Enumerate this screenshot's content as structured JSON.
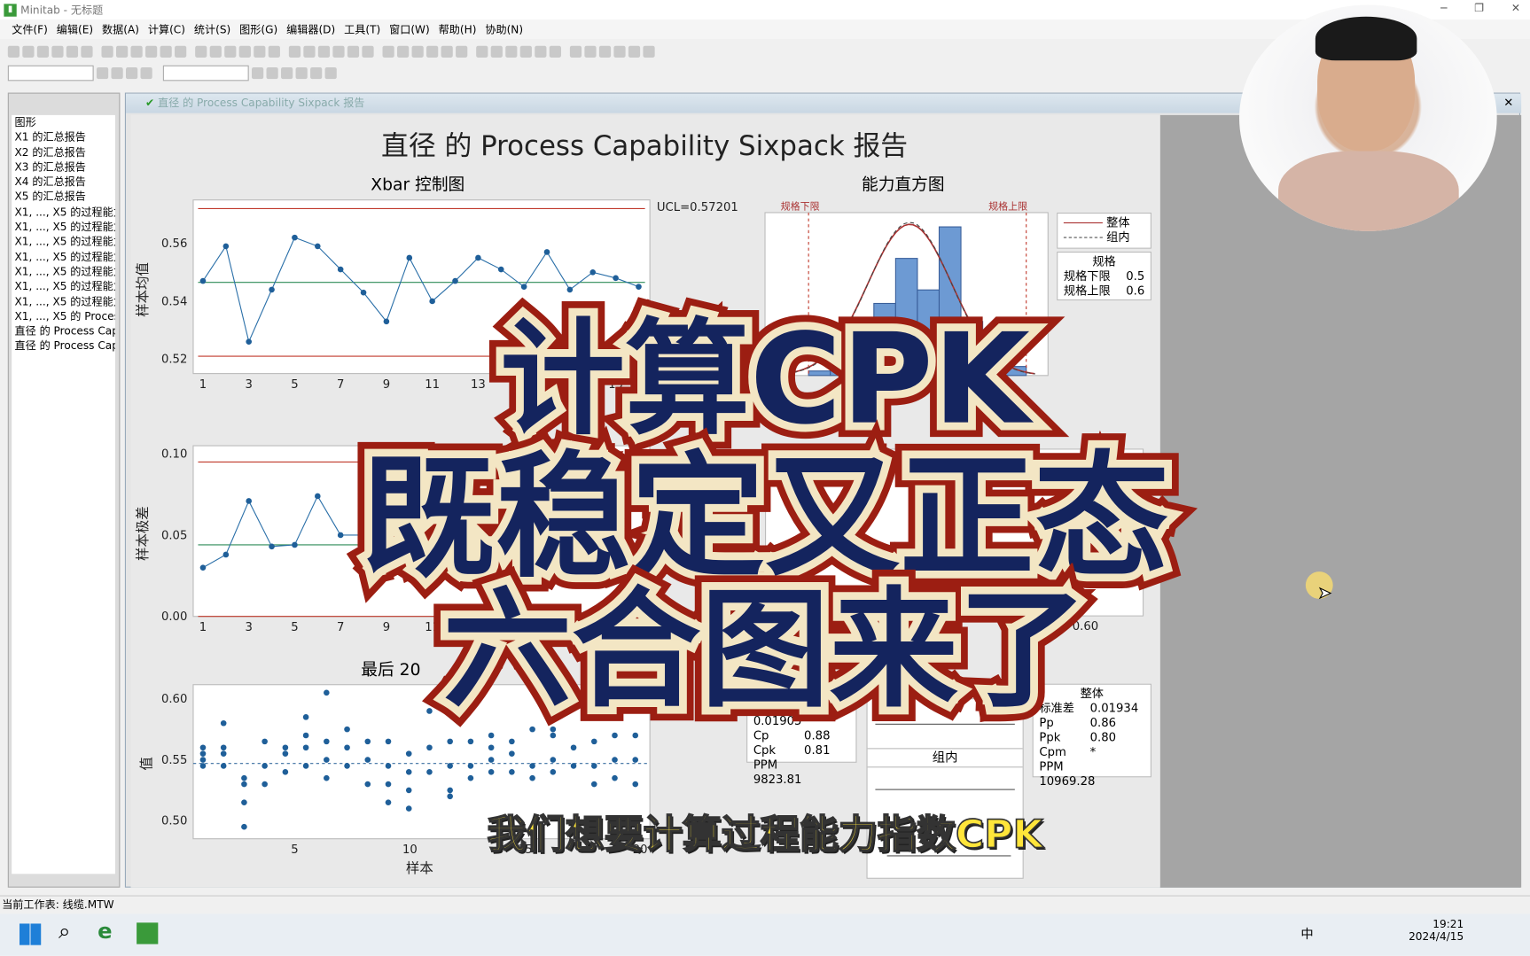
{
  "window": {
    "title": "Minitab - 无标题",
    "min": "─",
    "max": "❐",
    "close": "✕"
  },
  "menu": [
    "文件(F)",
    "编辑(E)",
    "数据(A)",
    "计算(C)",
    "统计(S)",
    "图形(G)",
    "编辑器(D)",
    "工具(T)",
    "窗口(W)",
    "帮助(H)",
    "协助(N)"
  ],
  "project": {
    "header": "图形",
    "items": [
      "X1 的汇总报告",
      "X2 的汇总报告",
      "X3 的汇总报告",
      "X4 的汇总报告",
      "X5 的汇总报告",
      "X1, ..., X5 的过程能力",
      "X1, ..., X5 的过程能力",
      "X1, ..., X5 的过程能力",
      "X1, ..., X5 的过程能力",
      "X1, ..., X5 的过程能力",
      "X1, ..., X5 的过程能力",
      "X1, ..., X5 的过程能力",
      "X1, ..., X5 的 Process",
      "直径 的 Process Cap",
      "直径 的 Process Cap"
    ]
  },
  "graph_window": {
    "title": "直径 的 Process Capability Sixpack 报告",
    "close": "✕"
  },
  "report": {
    "title": "直径 的 Process Capability Sixpack 报告",
    "xbar": {
      "title": "Xbar 控制图",
      "ylabel": "样本均值",
      "ucl_label": "UCL=0.57201"
    },
    "r": {
      "ylabel": "样本极差"
    },
    "last": {
      "title": "最后 20",
      "ylabel": "值",
      "xlabel": "样本"
    },
    "hist": {
      "title": "能力直方图",
      "lsl": "规格下限",
      "usl": "规格上限",
      "legend": [
        "整体",
        "组内"
      ],
      "spec_title": "规格",
      "spec": [
        {
          "k": "规格下限",
          "v": "0.5"
        },
        {
          "k": "规格上限",
          "v": "0.6"
        }
      ],
      "tick": "0.56"
    },
    "prob": {
      "tick": "0.60"
    },
    "within": {
      "title": "组内",
      "rows": [
        {
          "k": "标准差",
          "v": "0.01905"
        },
        {
          "k": "Cp",
          "v": "0.88"
        },
        {
          "k": "Cpk",
          "v": "0.81"
        },
        {
          "k": "PPM",
          "v": "9823.81"
        }
      ]
    },
    "overall": {
      "title": "整体",
      "rows": [
        {
          "k": "标准差",
          "v": "0.01934"
        },
        {
          "k": "Pp",
          "v": "0.86"
        },
        {
          "k": "Ppk",
          "v": "0.80"
        },
        {
          "k": "Cpm",
          "v": "*"
        },
        {
          "k": "PPM",
          "v": "10969.28"
        }
      ]
    },
    "capplot": {
      "overall": "整体",
      "within": "组内"
    }
  },
  "chart_data": [
    {
      "type": "line",
      "title": "Xbar 控制图",
      "ylabel": "样本均值",
      "x": [
        1,
        2,
        3,
        4,
        5,
        6,
        7,
        8,
        9,
        10,
        11,
        12,
        13,
        14,
        15,
        16,
        17,
        18,
        19,
        20
      ],
      "values": [
        0.547,
        0.559,
        0.526,
        0.544,
        0.562,
        0.559,
        0.551,
        0.543,
        0.533,
        0.555,
        0.54,
        0.547,
        0.555,
        0.551,
        0.545,
        0.557,
        0.544,
        0.55,
        0.548,
        0.545
      ],
      "ucl": 0.57201,
      "center": 0.5465,
      "lcl": 0.521,
      "ylim": [
        0.515,
        0.575
      ],
      "yticks": [
        "0.52",
        "0.54",
        "0.56"
      ],
      "xticks": [
        "1",
        "3",
        "5",
        "7",
        "9",
        "11",
        "13",
        "15",
        "17",
        "19"
      ],
      "colors": {
        "line": "#2a6fa8",
        "limits": "#c0392b",
        "center": "#2e8b57"
      }
    },
    {
      "type": "line",
      "ylabel": "样本极差",
      "x": [
        1,
        2,
        3,
        4,
        5,
        6,
        7,
        8,
        9,
        10,
        11,
        12,
        13,
        14,
        15,
        16,
        17,
        18,
        19,
        20
      ],
      "values": [
        0.03,
        0.038,
        0.071,
        0.043,
        0.044,
        0.074,
        0.05,
        0.05,
        0.045,
        0.04,
        0.025,
        0.045,
        0.05,
        0.04,
        0.035,
        0.03,
        0.022,
        0.045,
        0.06,
        0.068
      ],
      "ucl": 0.095,
      "center": 0.044,
      "lcl": 0,
      "ylim": [
        0,
        0.105
      ],
      "yticks": [
        "0.00",
        "0.05",
        "0.10"
      ],
      "xticks": [
        "1",
        "3",
        "5",
        "7",
        "9",
        "11",
        "13",
        "15",
        "17",
        "19"
      ]
    },
    {
      "type": "scatter",
      "title": "最后 20",
      "ylabel": "值",
      "xlabel": "样本",
      "ylim": [
        0.49,
        0.61
      ],
      "yticks": [
        "0.50",
        "0.55",
        "0.60"
      ],
      "xticks": [
        "5",
        "10",
        "15",
        "20"
      ],
      "center": 0.547,
      "points": [
        [
          1,
          0.56
        ],
        [
          1,
          0.555
        ],
        [
          1,
          0.55
        ],
        [
          1,
          0.545
        ],
        [
          2,
          0.58
        ],
        [
          2,
          0.56
        ],
        [
          2,
          0.555
        ],
        [
          2,
          0.545
        ],
        [
          3,
          0.535
        ],
        [
          3,
          0.53
        ],
        [
          3,
          0.515
        ],
        [
          3,
          0.495
        ],
        [
          4,
          0.565
        ],
        [
          4,
          0.545
        ],
        [
          4,
          0.53
        ],
        [
          5,
          0.56
        ],
        [
          5,
          0.555
        ],
        [
          5,
          0.54
        ],
        [
          6,
          0.585
        ],
        [
          6,
          0.57
        ],
        [
          6,
          0.56
        ],
        [
          6,
          0.545
        ],
        [
          7,
          0.605
        ],
        [
          7,
          0.565
        ],
        [
          7,
          0.55
        ],
        [
          7,
          0.535
        ],
        [
          8,
          0.575
        ],
        [
          8,
          0.56
        ],
        [
          8,
          0.545
        ],
        [
          9,
          0.565
        ],
        [
          9,
          0.55
        ],
        [
          9,
          0.53
        ],
        [
          10,
          0.565
        ],
        [
          10,
          0.545
        ],
        [
          10,
          0.53
        ],
        [
          10,
          0.515
        ],
        [
          11,
          0.555
        ],
        [
          11,
          0.54
        ],
        [
          11,
          0.525
        ],
        [
          11,
          0.51
        ],
        [
          12,
          0.59
        ],
        [
          12,
          0.56
        ],
        [
          12,
          0.54
        ],
        [
          13,
          0.565
        ],
        [
          13,
          0.545
        ],
        [
          13,
          0.525
        ],
        [
          13,
          0.52
        ],
        [
          14,
          0.565
        ],
        [
          14,
          0.545
        ],
        [
          14,
          0.535
        ],
        [
          15,
          0.57
        ],
        [
          15,
          0.56
        ],
        [
          15,
          0.55
        ],
        [
          15,
          0.54
        ],
        [
          16,
          0.565
        ],
        [
          16,
          0.555
        ],
        [
          16,
          0.54
        ],
        [
          17,
          0.575
        ],
        [
          17,
          0.545
        ],
        [
          17,
          0.535
        ],
        [
          18,
          0.575
        ],
        [
          18,
          0.57
        ],
        [
          18,
          0.55
        ],
        [
          18,
          0.54
        ],
        [
          19,
          0.56
        ],
        [
          19,
          0.545
        ],
        [
          20,
          0.565
        ],
        [
          20,
          0.545
        ],
        [
          20,
          0.53
        ],
        [
          21,
          0.57
        ],
        [
          21,
          0.55
        ],
        [
          21,
          0.535
        ],
        [
          22,
          0.57
        ],
        [
          22,
          0.55
        ],
        [
          22,
          0.53
        ]
      ]
    },
    {
      "type": "bar",
      "title": "能力直方图",
      "bins": [
        0.505,
        0.515,
        0.525,
        0.535,
        0.545,
        0.555,
        0.565,
        0.575,
        0.585,
        0.595
      ],
      "values": [
        1,
        3,
        10,
        16,
        26,
        19,
        33,
        12,
        4,
        2
      ],
      "lsl": 0.5,
      "usl": 0.6,
      "xlim": [
        0.48,
        0.61
      ]
    }
  ],
  "overlay": {
    "line1": "计算CPK",
    "line2": "既稳定又正态",
    "line3": "六合图来了",
    "subtitle": "我们想要计算过程能力指数CPK"
  },
  "status": {
    "worksheet": "当前工作表: 线缆.MTW"
  },
  "taskbar": {
    "time": "19:21",
    "date": "2024/4/15",
    "ime": "中"
  }
}
